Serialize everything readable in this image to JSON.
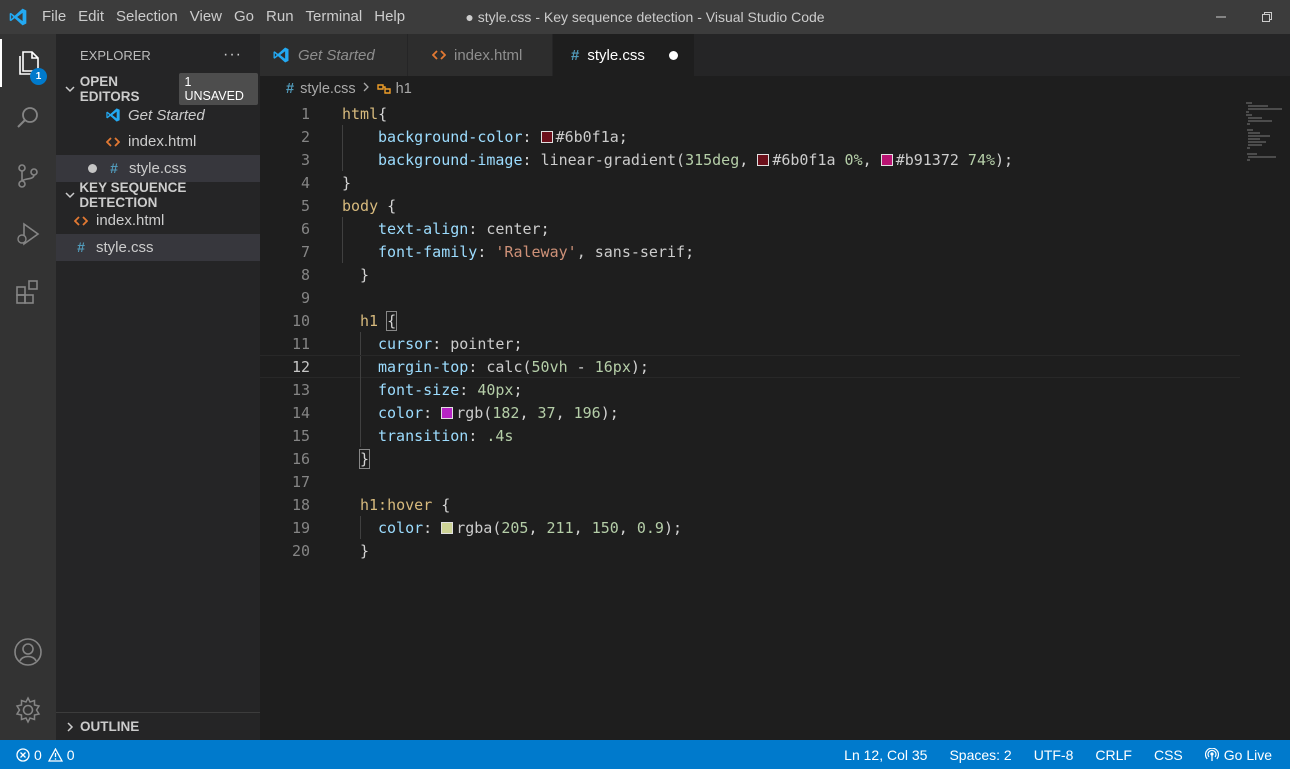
{
  "window": {
    "title": "● style.css - Key sequence detection - Visual Studio Code",
    "menu": [
      "File",
      "Edit",
      "Selection",
      "View",
      "Go",
      "Run",
      "Terminal",
      "Help"
    ]
  },
  "activity_bar": {
    "items": [
      "explorer-icon",
      "search-icon",
      "source-control-icon",
      "run-debug-icon",
      "extensions-icon"
    ],
    "explorer_badge": "1",
    "bottom": [
      "account-icon",
      "settings-gear-icon"
    ]
  },
  "sidebar": {
    "title": "EXPLORER",
    "more": "···",
    "open_editors": {
      "label": "OPEN EDITORS",
      "badge": "1 UNSAVED",
      "items": [
        {
          "name": "Get Started",
          "icon": "vscode-icon"
        },
        {
          "name": "index.html",
          "icon": "html-icon"
        },
        {
          "name": "style.css",
          "icon": "css-icon"
        }
      ]
    },
    "folder": {
      "label": "KEY SEQUENCE DETECTION",
      "items": [
        {
          "name": "index.html",
          "icon": "html-icon"
        },
        {
          "name": "style.css",
          "icon": "css-icon"
        }
      ]
    },
    "outline_label": "OUTLINE"
  },
  "tabs": [
    {
      "label": "Get Started",
      "icon": "vscode-icon"
    },
    {
      "label": "index.html",
      "icon": "html-icon"
    },
    {
      "label": "style.css",
      "icon": "css-icon"
    }
  ],
  "breadcrumb": {
    "file": "style.css",
    "symbol": "h1"
  },
  "editor": {
    "line_numbers": [
      "1",
      "2",
      "3",
      "4",
      "5",
      "6",
      "7",
      "8",
      "9",
      "10",
      "11",
      "12",
      "13",
      "14",
      "15",
      "16",
      "17",
      "18",
      "19",
      "20"
    ],
    "current_line": 12,
    "colors": {
      "c1": "#6b0f1a",
      "c2": "#b91372",
      "c3": "#b625c4",
      "c4": "#cdd396"
    },
    "tokens": {
      "l1_sel": "html",
      "l1_brace": "{",
      "l2_prop": "background-color",
      "l2_colon": ": ",
      "l2_val": "#6b0f1a",
      "l2_end": ";",
      "l3_prop": "background-image",
      "l3_colon": ": ",
      "l3_fn": "linear-gradient(",
      "l3_num1": "315deg",
      "l3_comma1": ", ",
      "l3_c1": "#6b0f1a",
      "l3_num2": " 0%",
      "l3_comma2": ", ",
      "l3_c2": "#b91372",
      "l3_num3": " 74%",
      "l3_end": ");",
      "l4": "}",
      "l5_sel": "body",
      "l5_brace": " {",
      "l6_prop": "text-align",
      "l6_colon": ": ",
      "l6_val": "center",
      "l6_end": ";",
      "l7_prop": "font-family",
      "l7_colon": ": ",
      "l7_str": "'Raleway'",
      "l7_val": ", sans-serif",
      "l7_end": ";",
      "l8": "}",
      "l10_sel": "h1",
      "l10_brace": "{",
      "l11_prop": "cursor",
      "l11_colon": ": ",
      "l11_val": "pointer",
      "l11_end": ";",
      "l12_prop": "margin-top",
      "l12_colon": ": ",
      "l12_fn": "calc(",
      "l12_num1": "50vh",
      "l12_op": " - ",
      "l12_num2": "16px",
      "l12_end": ");",
      "l13_prop": "font-size",
      "l13_colon": ": ",
      "l13_num": "40px",
      "l13_end": ";",
      "l14_prop": "color",
      "l14_colon": ": ",
      "l14_fn": "rgb(",
      "l14_n1": "182",
      "l14_c": ", ",
      "l14_n2": "37",
      "l14_c2": ", ",
      "l14_n3": "196",
      "l14_end": ");",
      "l15_prop": "transition",
      "l15_colon": ": ",
      "l15_num": ".4s",
      "l16": "}",
      "l18_sel": "h1:hover",
      "l18_brace": " {",
      "l19_prop": "color",
      "l19_colon": ": ",
      "l19_fn": "rgba(",
      "l19_n1": "205",
      "l19_c1": ", ",
      "l19_n2": "211",
      "l19_c2": ", ",
      "l19_n3": "150",
      "l19_c3": ", ",
      "l19_n4": "0.9",
      "l19_end": ");",
      "l20": "}"
    }
  },
  "status_bar": {
    "errors": "0",
    "warnings": "0",
    "position": "Ln 12, Col 35",
    "spaces": "Spaces: 2",
    "encoding": "UTF-8",
    "eol": "CRLF",
    "language": "CSS",
    "go_live": "Go Live"
  }
}
